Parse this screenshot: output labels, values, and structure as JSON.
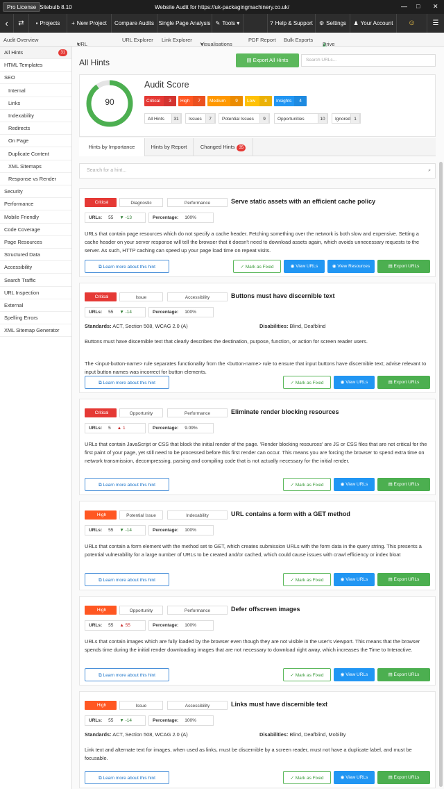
{
  "titlebar": {
    "license": "Pro License",
    "version": "Sitebulb 8.10",
    "window_title": "Website Audit for https://uk-packagingmachinery.co.uk/",
    "controls": [
      "—",
      "□",
      "✕"
    ]
  },
  "toolbar": {
    "back": "‹",
    "swap": "⇄",
    "items": [
      {
        "label": "Projects",
        "icon": "folder-icon"
      },
      {
        "label": "New Project",
        "icon": "plus-icon"
      },
      {
        "label": "Compare Audits",
        "icon": ""
      },
      {
        "label": "Single Page Analysis",
        "icon": ""
      },
      {
        "label": "Tools",
        "icon": "wrench-icon"
      },
      {
        "label": "Help & Support",
        "icon": "question-icon"
      },
      {
        "label": "Settings",
        "icon": "gear-icon"
      },
      {
        "label": "Your Account",
        "icon": "users-icon"
      }
    ],
    "emoji": "☺",
    "menu": "☰"
  },
  "subnav": {
    "items": [
      "Audit Overview",
      "URL Reports",
      "URL Explorer",
      "Link Explorer",
      "Visualisations",
      "PDF Report",
      "Bulk Exports",
      "Drive"
    ]
  },
  "sidebar": {
    "items": [
      {
        "label": "All Hints",
        "badge": "31",
        "sub": false,
        "active": true
      },
      {
        "label": "HTML Templates",
        "sub": false
      },
      {
        "label": "SEO",
        "sub": false
      },
      {
        "label": "Internal",
        "sub": true
      },
      {
        "label": "Links",
        "sub": true
      },
      {
        "label": "Indexability",
        "sub": true
      },
      {
        "label": "Redirects",
        "sub": true
      },
      {
        "label": "On Page",
        "sub": true
      },
      {
        "label": "Duplicate Content",
        "sub": true
      },
      {
        "label": "XML Sitemaps",
        "sub": true
      },
      {
        "label": "Response vs Render",
        "sub": true
      },
      {
        "label": "Security",
        "sub": false
      },
      {
        "label": "Performance",
        "sub": false
      },
      {
        "label": "Mobile Friendly",
        "sub": false
      },
      {
        "label": "Code Coverage",
        "sub": false
      },
      {
        "label": "Page Resources",
        "sub": false
      },
      {
        "label": "Structured Data",
        "sub": false
      },
      {
        "label": "Accessibility",
        "sub": false
      },
      {
        "label": "Search Traffic",
        "sub": false
      },
      {
        "label": "URL Inspection",
        "sub": false
      },
      {
        "label": "External",
        "sub": false
      },
      {
        "label": "Spelling Errors",
        "sub": false
      },
      {
        "label": "XML Sitemap Generator",
        "sub": false
      }
    ]
  },
  "main": {
    "title": "All Hints",
    "export_all": "Export All Hints",
    "search_urls_placeholder": "Search URLs...",
    "score": {
      "value": "90",
      "fraction": 0.9,
      "heading": "Audit Score",
      "severities": [
        {
          "label": "Critical",
          "count": "3",
          "color": "#e53935"
        },
        {
          "label": "High",
          "count": "7",
          "color": "#ff5722"
        },
        {
          "label": "Medium",
          "count": "9",
          "color": "#ff9800"
        },
        {
          "label": "Low",
          "count": "8",
          "color": "#ffc107"
        },
        {
          "label": "Insights",
          "count": "4",
          "color": "#2196f3"
        }
      ],
      "counts": [
        {
          "label": "All Hints",
          "count": "31"
        },
        {
          "label": "Issues",
          "count": "7"
        },
        {
          "label": "Potential Issues",
          "count": "9"
        },
        {
          "label": "Opportunities",
          "count": "10"
        },
        {
          "label": "Ignored",
          "count": "1"
        }
      ]
    },
    "tabs": [
      {
        "label": "Hints by Importance"
      },
      {
        "label": "Hints by Report"
      },
      {
        "label": "Changed Hints",
        "badge": "35"
      }
    ],
    "hint_search_placeholder": "Search for a hint...",
    "buttons": {
      "learn": "Learn more about this hint",
      "fixed": "Mark as Fixed",
      "view_urls": "View URLs",
      "view_resources": "View Resources",
      "export_urls": "Export URLs"
    }
  },
  "hints": [
    {
      "severity": "Critical",
      "severity_color": "#e53935",
      "type": "Diagnostic",
      "category": "Performance",
      "title": "Serve static assets with an efficient cache policy",
      "urls_label": "URLs:",
      "urls": "55",
      "change": "▼ -13",
      "change_dir": "down",
      "percentage_label": "Percentage:",
      "percentage": "100%",
      "paragraphs": [
        "URLs that contain page resources which do not specify a cache header. Fetching something over the network is both slow and expensive. Setting a cache header on your server response will tell the browser that it doesn't need to download assets again, which avoids unnecessary requests to the server. As such, HTTP caching can speed up your page load time on repeat visits."
      ],
      "view_resources": true
    },
    {
      "severity": "Critical",
      "severity_color": "#e53935",
      "type": "Issue",
      "category": "Accessibility",
      "title": "Buttons must have discernible text",
      "urls_label": "URLs:",
      "urls": "55",
      "change": "▼ -14",
      "change_dir": "down",
      "percentage_label": "Percentage:",
      "percentage": "100%",
      "standards_label": "Standards:",
      "standards": "ACT, Section 508, WCAG 2.0 (A)",
      "disabilities_label": "Disabilities:",
      "disabilities": "Blind, Deafblind",
      "paragraphs": [
        "Buttons must have discernible text that clearly describes the destination, purpose, function, or action for screen reader users.",
        "The <input-button-name> rule separates functionality from the <button-name> rule to ensure that input buttons have discernible text; advise relevant to input button names was incorrect for button elements."
      ]
    },
    {
      "severity": "Critical",
      "severity_color": "#e53935",
      "type": "Opportunity",
      "category": "Performance",
      "title": "Eliminate render blocking resources",
      "urls_label": "URLs:",
      "urls": "5",
      "change": "▲ 1",
      "change_dir": "up",
      "percentage_label": "Percentage:",
      "percentage": "9.09%",
      "paragraphs": [
        "URLs that contain JavaScript or CSS that block the initial render of the page. 'Render blocking resources' are JS or CSS files that are not critical for the first paint of your page, yet still need to be processed before this first render can occur. This means you are forcing the browser to spend extra time on network transmission, decompressing, parsing and compiling code that is not actually necessary for the initial render."
      ]
    },
    {
      "severity": "High",
      "severity_color": "#ff5722",
      "type": "Potential Issue",
      "category": "Indexability",
      "title": "URL contains a form with a GET method",
      "urls_label": "URLs:",
      "urls": "55",
      "change": "▼ -14",
      "change_dir": "down",
      "percentage_label": "Percentage:",
      "percentage": "100%",
      "paragraphs": [
        "URLs that contain a form element with the method set to GET, which creates submission URLs with the form data in the query string. This presents a potential vulnerability for a large number of URLs to be created and/or cached, which could cause issues with crawl efficiency or index bloat"
      ]
    },
    {
      "severity": "High",
      "severity_color": "#ff5722",
      "type": "Opportunity",
      "category": "Performance",
      "title": "Defer offscreen images",
      "urls_label": "URLs:",
      "urls": "55",
      "change": "▲ 55",
      "change_dir": "up",
      "percentage_label": "Percentage:",
      "percentage": "100%",
      "paragraphs": [
        "URLs that contain images which are fully loaded by the browser even though they are not visible in the user's viewport. This means that the browser spends time during the initial render downloading images that are not necessary to download right away, which increases the Time to Interactive."
      ]
    },
    {
      "severity": "High",
      "severity_color": "#ff5722",
      "type": "Issue",
      "category": "Accessibility",
      "title": "Links must have discernible text",
      "urls_label": "URLs:",
      "urls": "55",
      "change": "▼ -14",
      "change_dir": "down",
      "percentage_label": "Percentage:",
      "percentage": "100%",
      "standards_label": "Standards:",
      "standards": "ACT, Section 508, WCAG 2.0 (A)",
      "disabilities_label": "Disabilities:",
      "disabilities": "Blind, Deafblind, Mobility",
      "paragraphs": [
        "Link text and alternate text for images, when used as links, must be discernible by a screen reader, must not have a duplicate label, and must be focusable."
      ]
    }
  ]
}
